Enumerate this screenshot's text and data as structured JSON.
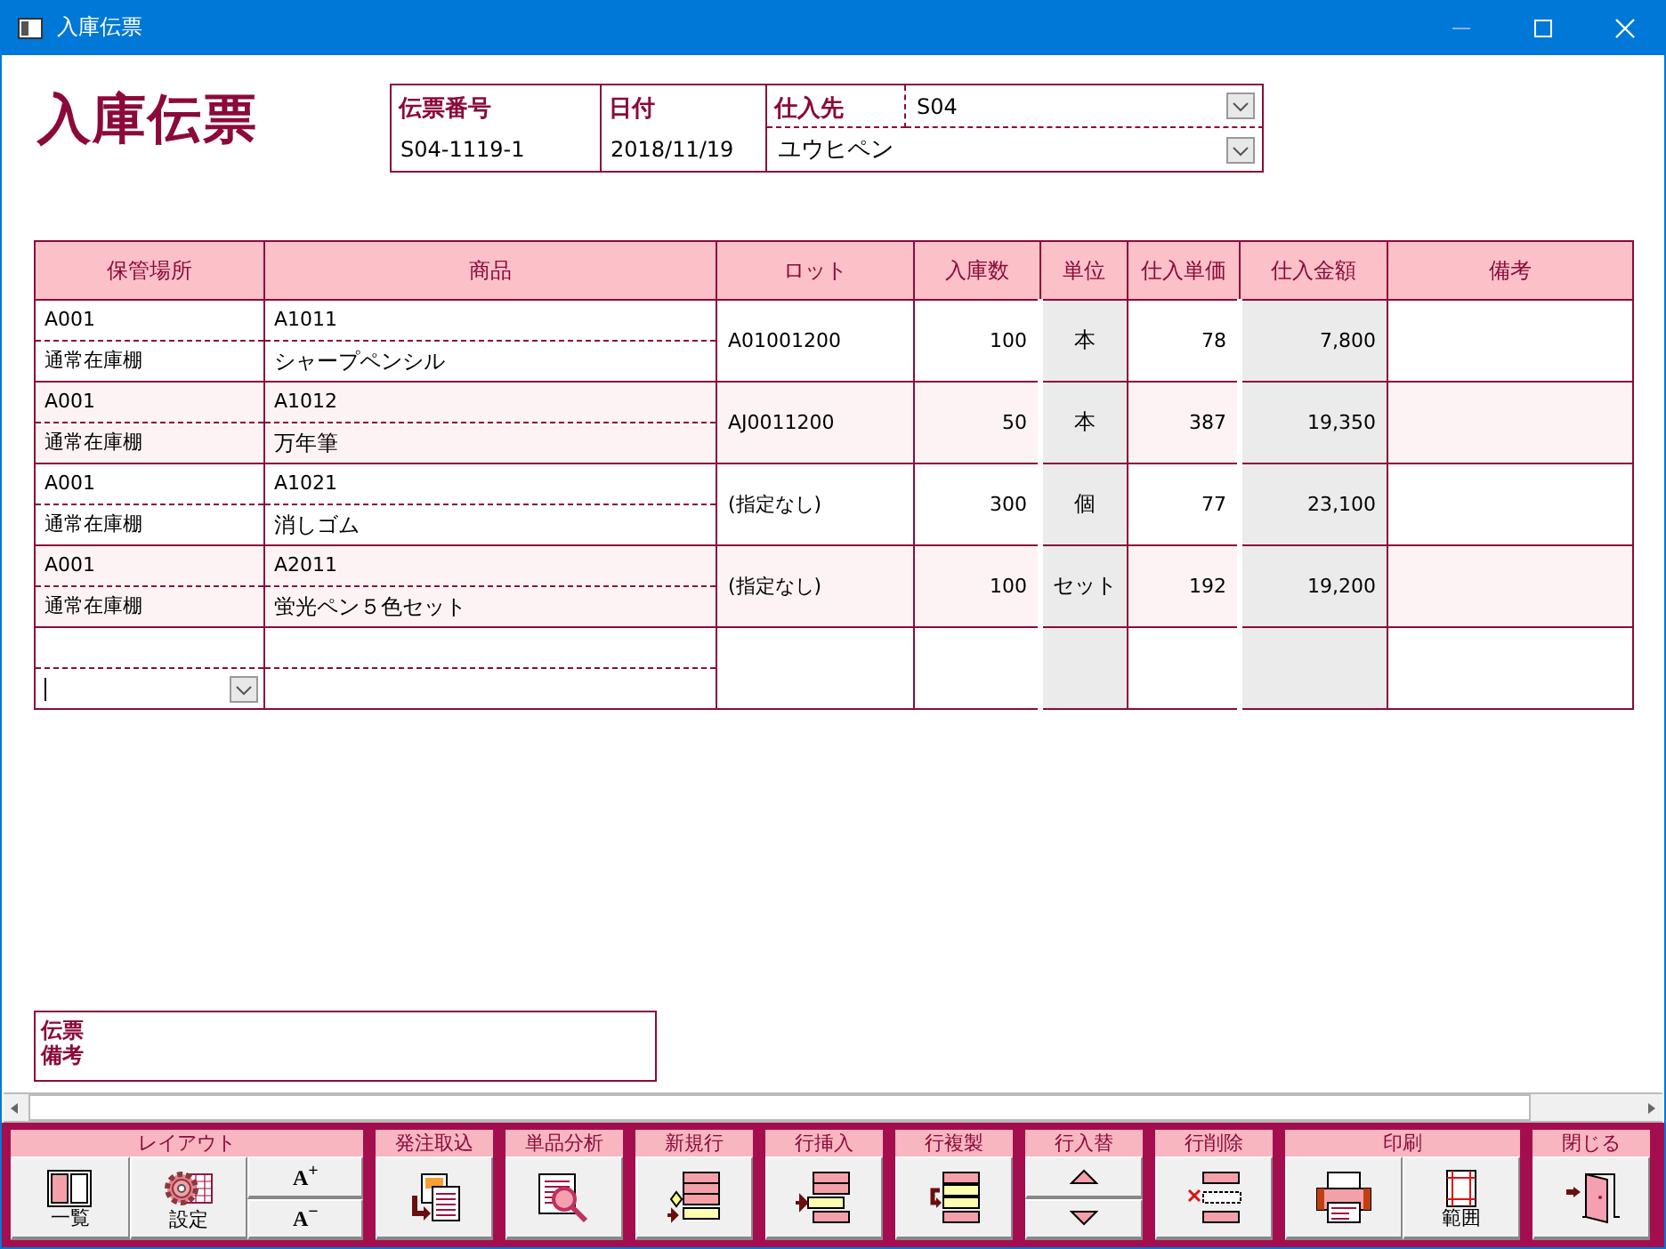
{
  "window": {
    "title": "入庫伝票"
  },
  "heading": "入庫伝票",
  "header": {
    "slip_number": {
      "label": "伝票番号",
      "value": "S04-1119-1"
    },
    "date": {
      "label": "日付",
      "value": "2018/11/19"
    },
    "supplier": {
      "label": "仕入先",
      "code": "S04",
      "name": "ユウヒペン"
    }
  },
  "table": {
    "columns": [
      {
        "label": "保管場所",
        "readonly": false
      },
      {
        "label": "商品",
        "readonly": false
      },
      {
        "label": "ロット",
        "readonly": false
      },
      {
        "label": "入庫数",
        "readonly": false
      },
      {
        "label": "単位",
        "readonly": true
      },
      {
        "label": "仕入単価",
        "readonly": false
      },
      {
        "label": "仕入金額",
        "readonly": true
      },
      {
        "label": "備考",
        "readonly": false
      }
    ],
    "rows": [
      {
        "location_code": "A001",
        "location_name": "通常在庫棚",
        "item_code": "A1011",
        "item_name": "シャープペンシル",
        "lot": "A01001200",
        "quantity": "100",
        "unit": "本",
        "unit_price": "78",
        "amount": "7,800"
      },
      {
        "location_code": "A001",
        "location_name": "通常在庫棚",
        "item_code": "A1012",
        "item_name": "万年筆",
        "lot": "AJ0011200",
        "quantity": "50",
        "unit": "本",
        "unit_price": "387",
        "amount": "19,350"
      },
      {
        "location_code": "A001",
        "location_name": "通常在庫棚",
        "item_code": "A1021",
        "item_name": "消しゴム",
        "lot": "(指定なし)",
        "quantity": "300",
        "unit": "個",
        "unit_price": "77",
        "amount": "23,100"
      },
      {
        "location_code": "A001",
        "location_name": "通常在庫棚",
        "item_code": "A2011",
        "item_name": "蛍光ペン５色セット",
        "lot": "(指定なし)",
        "quantity": "100",
        "unit": "セット",
        "unit_price": "192",
        "amount": "19,200"
      }
    ]
  },
  "remarks": {
    "label": "伝票備考"
  },
  "toolbar": {
    "groups": [
      {
        "label": "レイアウト",
        "buttons": [
          {
            "kind": "list",
            "label": "一覧"
          },
          {
            "kind": "settings",
            "label": "設定"
          },
          {
            "kind": "stacked",
            "parts": [
              {
                "kind": "font-larger",
                "label": "A$^{+}$"
              },
              {
                "kind": "font-smaller",
                "label": "A$^{−}$"
              }
            ]
          }
        ]
      },
      {
        "label": "発注取込",
        "buttons": [
          {
            "kind": "import"
          }
        ]
      },
      {
        "label": "単品分析",
        "buttons": [
          {
            "kind": "analyze"
          }
        ]
      },
      {
        "label": "新規行",
        "buttons": [
          {
            "kind": "new-row"
          }
        ]
      },
      {
        "label": "行挿入",
        "buttons": [
          {
            "kind": "insert-row"
          }
        ]
      },
      {
        "label": "行複製",
        "buttons": [
          {
            "kind": "duplicate-row"
          }
        ]
      },
      {
        "label": "行入替",
        "buttons": [
          {
            "kind": "stacked",
            "parts": [
              {
                "kind": "move-up"
              },
              {
                "kind": "move-down"
              }
            ]
          }
        ]
      },
      {
        "label": "行削除",
        "buttons": [
          {
            "kind": "delete-row"
          }
        ]
      },
      {
        "label": "印刷",
        "buttons": [
          {
            "kind": "print"
          },
          {
            "kind": "print-range",
            "label": "範囲"
          }
        ]
      },
      {
        "label": "閉じる",
        "buttons": [
          {
            "kind": "close"
          }
        ]
      }
    ]
  }
}
